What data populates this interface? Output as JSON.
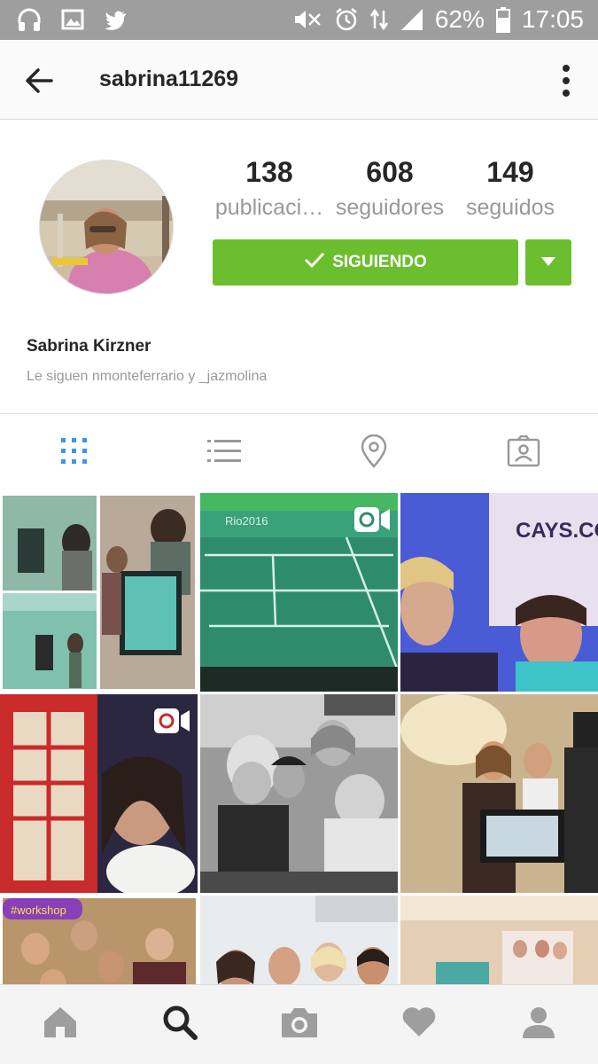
{
  "status_bar": {
    "battery": "62%",
    "time": "17:05",
    "icons": [
      "headphones-icon",
      "image-icon",
      "twitter-icon",
      "mute-icon",
      "alarm-icon",
      "data-icon",
      "signal-icon",
      "battery-icon"
    ]
  },
  "header": {
    "username": "sabrina11269"
  },
  "profile": {
    "stats": [
      {
        "value": "138",
        "label": "publicaci…"
      },
      {
        "value": "608",
        "label": "seguidores"
      },
      {
        "value": "149",
        "label": "seguidos"
      }
    ],
    "follow_button_label": "SIGUIENDO",
    "full_name": "Sabrina Kirzner",
    "followed_by": "Le siguen nmonteferrario y _jazmolina"
  },
  "tabs": [
    "grid-icon",
    "list-icon",
    "location-pin-icon",
    "tagged-photos-icon"
  ],
  "active_tab": "grid-icon",
  "bottom_nav": [
    "home-icon",
    "search-icon",
    "camera-icon",
    "heart-icon",
    "profile-icon"
  ],
  "active_nav": "search-icon",
  "colors": {
    "accent_green": "#6bbf2f",
    "tab_active_blue": "#3897f0",
    "status_bar": "#9e9e9e"
  }
}
